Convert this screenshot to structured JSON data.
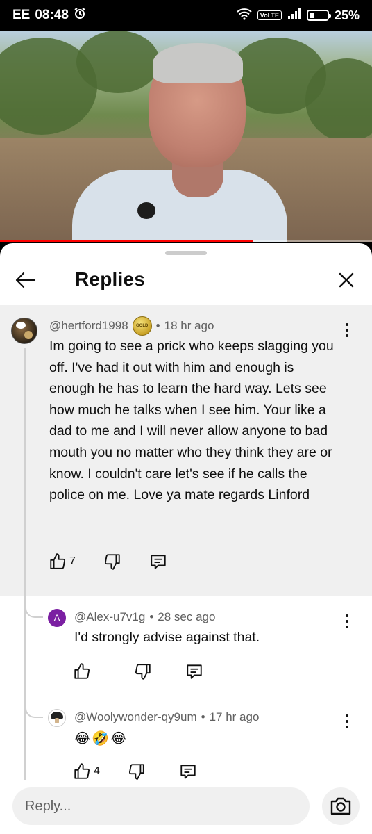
{
  "status_bar": {
    "carrier": "EE",
    "time": "08:48",
    "volte": "VoLTE",
    "battery": "25%"
  },
  "video": {
    "progress_fraction": 0.68
  },
  "sheet": {
    "title": "Replies"
  },
  "parent_comment": {
    "author": "@hertford1998",
    "badge_text": "GOLD",
    "time": "18 hr ago",
    "text": "Im going to  see  a prick who keeps slagging you off. I've had it out with him and enough is enough he has to learn the hard way.  Lets see how much he talks when I see him. Your like a dad to me and I will never allow anyone to bad mouth you no matter who they think they are or know.  I couldn't care  let's see if he calls the police on me.  Love ya mate regards Linford",
    "likes": "7"
  },
  "replies": [
    {
      "avatar_letter": "A",
      "author": "@Alex-u7v1g",
      "time": "28 sec ago",
      "text": "I'd strongly advise against that.",
      "likes": ""
    },
    {
      "author": "@Woolywonder-qy9um",
      "time": "17 hr ago",
      "text": "😂🤣😂",
      "likes": "4"
    }
  ],
  "footer": {
    "placeholder": "Reply..."
  },
  "icons": [
    "wifi-icon",
    "signal-icon",
    "battery-icon",
    "alarm-icon",
    "back-arrow-icon",
    "close-icon",
    "more-vert-icon",
    "thumb-up-icon",
    "thumb-down-icon",
    "reply-icon",
    "camera-icon"
  ],
  "colors": {
    "progress": "#ff0000",
    "alex_avatar": "#7b1fa2",
    "parent_bg": "#f0f0f0"
  }
}
